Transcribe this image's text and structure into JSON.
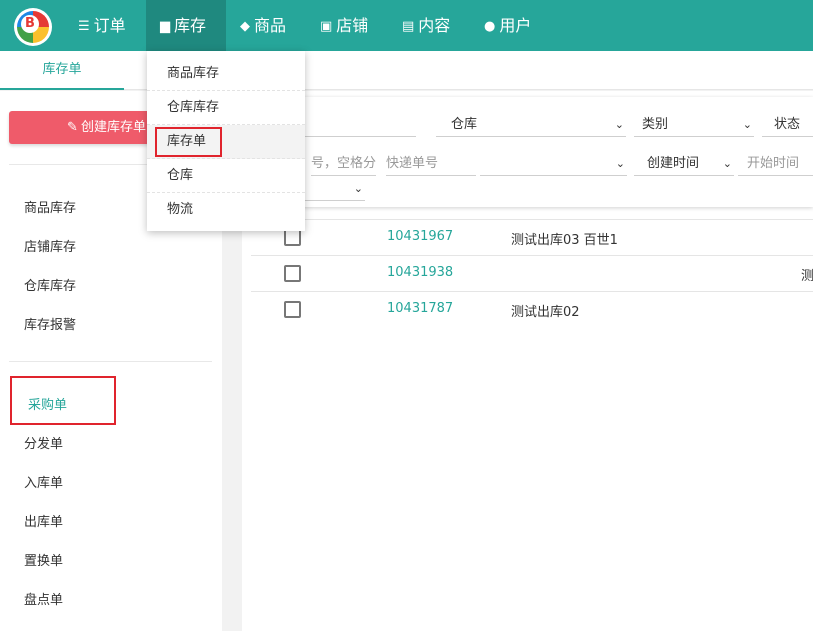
{
  "nav": {
    "logo_letter": "B",
    "items": [
      {
        "label": "订单",
        "icon": "list-icon"
      },
      {
        "label": "库存",
        "icon": "store-icon"
      },
      {
        "label": "商品",
        "icon": "layers-icon"
      },
      {
        "label": "店铺",
        "icon": "shop-icon"
      },
      {
        "label": "内容",
        "icon": "message-icon"
      },
      {
        "label": "用户",
        "icon": "users-icon"
      }
    ]
  },
  "tabs": {
    "active": "库存单"
  },
  "sidebar": {
    "create_button": "创建库存单",
    "group1": [
      "商品库存",
      "店铺库存",
      "仓库库存",
      "库存报警"
    ],
    "group2": [
      "采购单",
      "分发单",
      "入库单",
      "出库单",
      "置换单",
      "盘点单"
    ]
  },
  "dropdown": {
    "items": [
      "商品库存",
      "仓库库存",
      "库存单",
      "仓库",
      "物流"
    ]
  },
  "filters": {
    "warehouse": "仓库",
    "category": "类别",
    "status": "状态",
    "search_placeholder": "号，空格分",
    "tracking_placeholder": "快递单号",
    "created_time": "创建时间",
    "start_time": "开始时间"
  },
  "table": {
    "rows": [
      {
        "id": "10431967",
        "name": "测试出库03 百世1",
        "extra": ""
      },
      {
        "id": "10431938",
        "name": "",
        "extra": "测"
      },
      {
        "id": "10431787",
        "name": "测试出库02",
        "extra": ""
      }
    ]
  }
}
